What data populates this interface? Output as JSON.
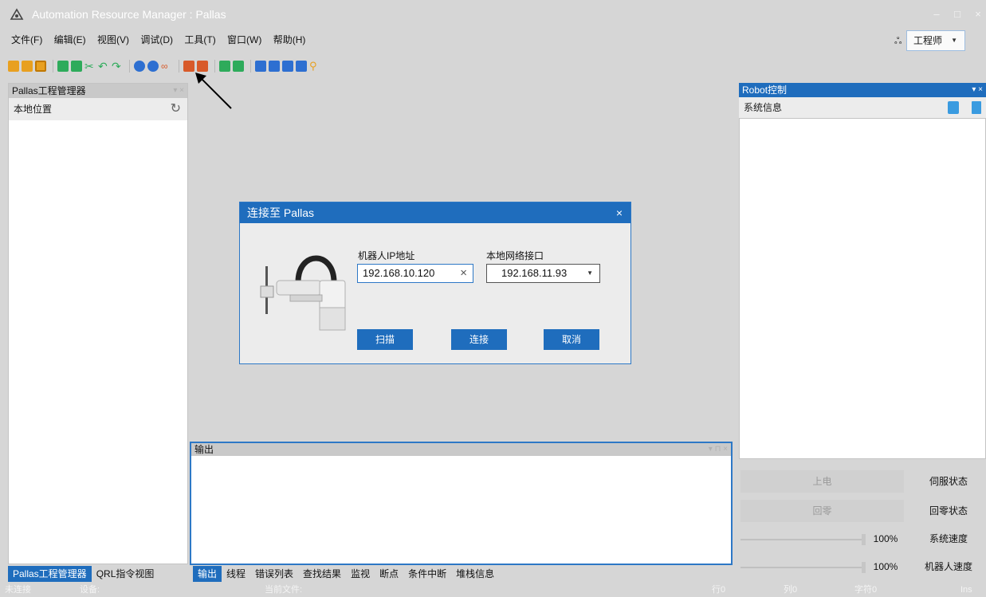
{
  "window": {
    "title": "Automation Resource Manager : Pallas",
    "app_icon": "robot-logo-icon",
    "minimize": "–",
    "maximize": "□",
    "close": "×"
  },
  "menu": [
    {
      "label": "文件(F)"
    },
    {
      "label": "编辑(E)"
    },
    {
      "label": "视图(V)"
    },
    {
      "label": "调试(D)"
    },
    {
      "label": "工具(T)"
    },
    {
      "label": "窗口(W)"
    },
    {
      "label": "帮助(H)"
    }
  ],
  "user": {
    "icon": "users-icon",
    "glyph": "ஃ",
    "role": "工程师",
    "caret": "▼"
  },
  "toolbar": {
    "icons": [
      "open-folder-icon",
      "save-icon",
      "save-all-icon",
      "copy-icon",
      "paste-icon",
      "cut-icon",
      "undo-icon",
      "redo-icon",
      "step-back-icon",
      "step-forward-icon",
      "link-icon",
      "indent-icon",
      "outdent-icon",
      "comment-icon",
      "uncomment-icon",
      "bookmark-icon",
      "bookmark-prev-icon",
      "bookmark-next-icon",
      "bookmark-clear-icon",
      "find-icon"
    ],
    "colors": {
      "orange": "#e8a020",
      "green": "#2eab5b",
      "blue": "#2d6fd1",
      "red": "#d85a2a"
    }
  },
  "left_panel": {
    "title": "Pallas工程管理器",
    "header_controls": "▾ ×",
    "local_position": "本地位置",
    "refresh_glyph": "↻"
  },
  "left_tabs": [
    {
      "label": "Pallas工程管理器",
      "active": true
    },
    {
      "label": "QRL指令视图",
      "active": false
    }
  ],
  "output_panel": {
    "title": "输出",
    "header_controls": "▾ ⊓ ×"
  },
  "output_tabs": [
    {
      "label": "输出",
      "active": true
    },
    {
      "label": "线程",
      "active": false
    },
    {
      "label": "错误列表",
      "active": false
    },
    {
      "label": "查找结果",
      "active": false
    },
    {
      "label": "监视",
      "active": false
    },
    {
      "label": "断点",
      "active": false
    },
    {
      "label": "条件中断",
      "active": false
    },
    {
      "label": "堆栈信息",
      "active": false
    }
  ],
  "robot_panel": {
    "title": "Robot控制",
    "header_controls": "▾ ×",
    "system_info": "系统信息",
    "power_on": "上电",
    "servo_status": "伺服状态",
    "home": "回零",
    "home_status": "回零状态",
    "system_speed": {
      "value": "100%",
      "label": "系统速度",
      "level": 1.0
    },
    "robot_speed": {
      "value": "100%",
      "label": "机器人速度",
      "level": 1.0
    }
  },
  "statusbar": {
    "connection": "未连接",
    "device": "设备:",
    "current_file": "当前文件:",
    "row": "行0",
    "col": "列0",
    "chars": "字符0",
    "mode": "Ins"
  },
  "dialog": {
    "title": "连接至 Pallas",
    "close": "×",
    "ip_label": "机器人IP地址",
    "ip_value": "192.168.10.120",
    "clear_glyph": "×",
    "iface_label": "本地网络接口",
    "iface_value": "192.168.11.93",
    "iface_caret": "▼",
    "scan": "扫描",
    "connect": "连接",
    "cancel": "取消"
  },
  "annotation": {
    "arrow": "arrow-pointer-icon"
  }
}
